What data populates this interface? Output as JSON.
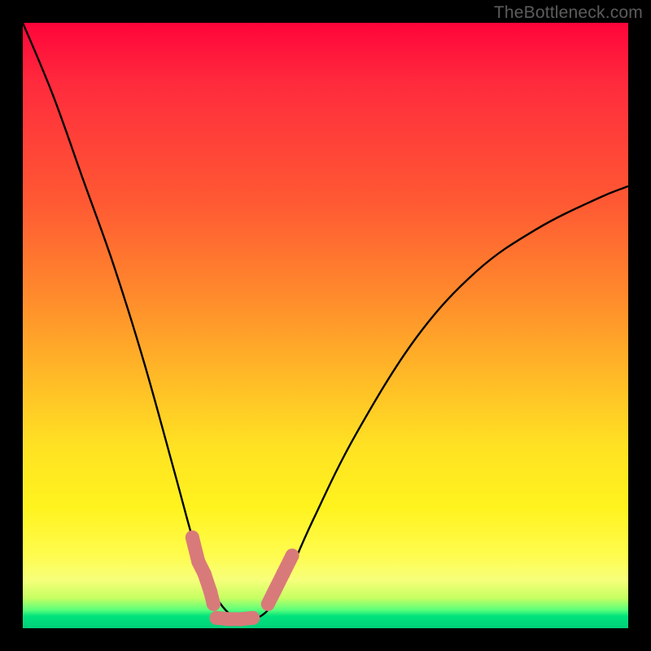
{
  "watermark": "TheBottleneck.com",
  "chart_data": {
    "type": "line",
    "title": "",
    "xlabel": "",
    "ylabel": "",
    "xlim": [
      0,
      100
    ],
    "ylim": [
      0,
      100
    ],
    "series": [
      {
        "name": "main-curve",
        "x": [
          0,
          5,
          10,
          15,
          20,
          25,
          28,
          30,
          32,
          34,
          36,
          38,
          40,
          42,
          44,
          48,
          55,
          65,
          75,
          85,
          95,
          100
        ],
        "y": [
          100,
          88,
          74,
          60,
          44,
          26,
          15,
          9,
          5,
          2.5,
          1.5,
          1.5,
          2.5,
          5,
          9,
          18,
          32,
          48,
          59,
          66,
          71,
          73
        ]
      },
      {
        "name": "marker-band-left",
        "x": [
          28,
          29,
          30,
          31,
          31.5
        ],
        "y": [
          15,
          11,
          9,
          6,
          4
        ]
      },
      {
        "name": "marker-band-bottom",
        "x": [
          32,
          34,
          36,
          38
        ],
        "y": [
          1.7,
          1.5,
          1.5,
          1.7
        ]
      },
      {
        "name": "marker-band-right",
        "x": [
          40.5,
          41.5,
          43,
          44.5
        ],
        "y": [
          4,
          6,
          9,
          12
        ]
      }
    ],
    "colors": {
      "curve": "#000000",
      "markers": "#d97a7a",
      "gradient_top": "#ff043a",
      "gradient_mid": "#ffe223",
      "gradient_bottom": "#00d07a"
    }
  }
}
